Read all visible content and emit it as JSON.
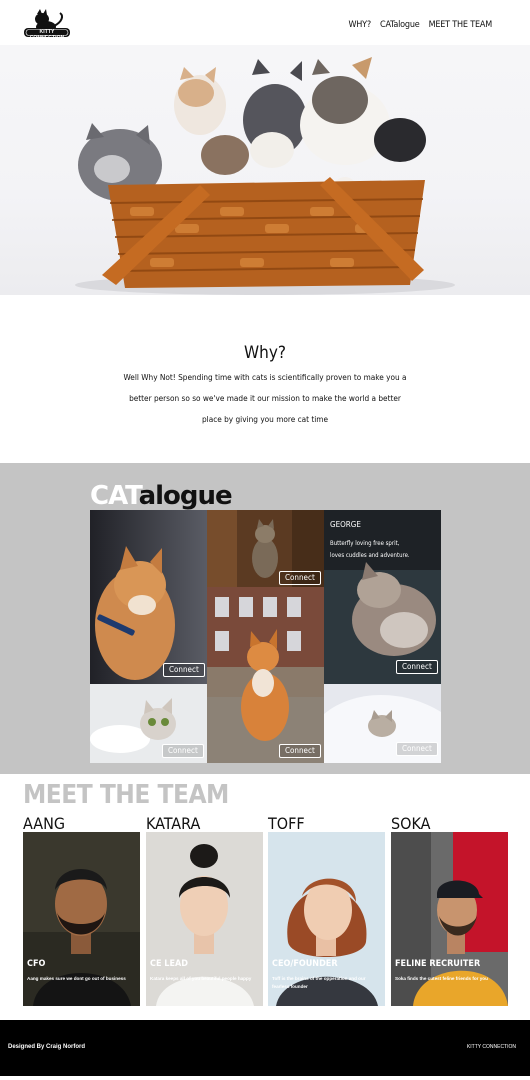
{
  "nav": {
    "logo_text": "KITTY CONNECTION",
    "links": [
      "WHY?",
      "CATalogue",
      "MEET THE TEAM"
    ]
  },
  "why": {
    "heading": "Why?",
    "body": "Well Why Not! Spending time with cats is scientifically proven to make you a better person so so we've made it our mission to make the world a better place by giving you more cat time"
  },
  "catalogue": {
    "title_a": "CAT",
    "title_b": "alogue",
    "connect_label": "Connect",
    "featured": {
      "name": "GEORGE",
      "description": "Butterfly loving free sprit, loves cuddles and adventure."
    }
  },
  "team": {
    "title": "MEET THE TEAM",
    "members": [
      {
        "name": "AANG",
        "role": "CFO",
        "description": "Aang makes sure we dont go out of business"
      },
      {
        "name": "KATARA",
        "role": "CE LEAD",
        "description": "Katara keeps all of you beautiful people happy"
      },
      {
        "name": "TOFF",
        "role": "CEO/FOUNDER",
        "description": "Toff is the brains of the opperation and our fearless founder"
      },
      {
        "name": "SOKA",
        "role": "FELINE RECRUITER",
        "description": "Soka finds the cutest feline friends for you"
      }
    ]
  },
  "footer": {
    "credit": "Designed By Craig Norford",
    "brand": "KITTY CONNECTION"
  },
  "colors": {
    "catalogue_bg": "#c4c4c4",
    "team_title": "#c4c4c4",
    "footer_bg": "#000000"
  }
}
